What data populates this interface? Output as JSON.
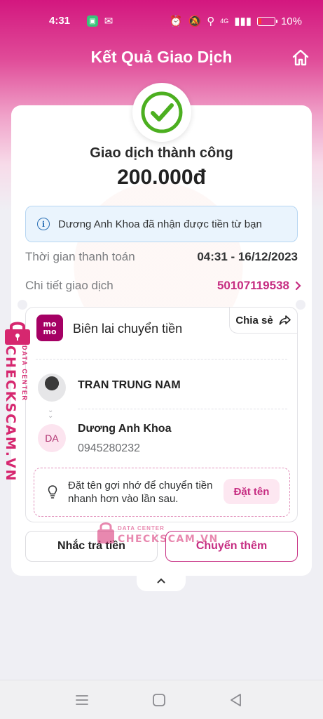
{
  "status_bar": {
    "time": "4:31",
    "network": "4G",
    "battery": "10%"
  },
  "header": {
    "title": "Kết Quả Giao Dịch"
  },
  "result": {
    "status": "Giao dịch thành công",
    "amount": "200.000đ"
  },
  "notice": {
    "text": "Dương Anh Khoa đã nhận được tiền từ bạn"
  },
  "details": {
    "time_label": "Thời gian thanh toán",
    "time_value": "04:31 - 16/12/2023",
    "id_label": "Chi tiết giao dịch",
    "id_value": "50107119538"
  },
  "receipt": {
    "logo_line1": "mo",
    "logo_line2": "mo",
    "title": "Biên lai chuyển tiền",
    "share_label": "Chia sẻ",
    "sender_name": "TRAN TRUNG NAM",
    "recipient_initials": "DA",
    "recipient_name": "Dương Anh Khoa",
    "recipient_phone": "0945280232",
    "tip_text": "Đặt tên gợi nhớ để chuyển tiền nhanh hơn vào lần sau.",
    "name_button": "Đặt tên"
  },
  "actions": {
    "remind_label": "Nhắc trả tiền",
    "send_more_label": "Chuyển thêm"
  },
  "watermark": {
    "main": "CHECKSCAM.VN",
    "sub": "DATA CENTER"
  },
  "colors": {
    "brand": "#c62d82",
    "success": "#4caf20",
    "header_gradient_top": "#d3177f"
  }
}
